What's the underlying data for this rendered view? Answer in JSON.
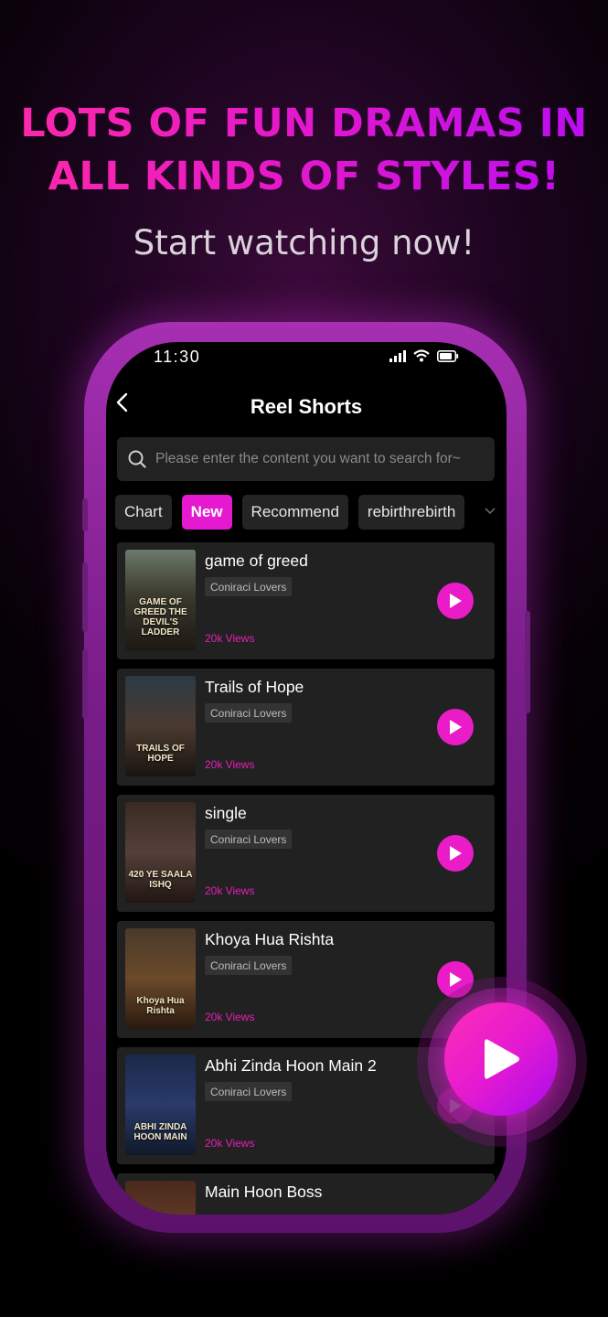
{
  "promo": {
    "headline_line1": "LOTS OF FUN DRAMAS IN",
    "headline_line2": "ALL KINDS OF STYLES!",
    "subheadline": "Start watching now!"
  },
  "status_bar": {
    "time": "11:30"
  },
  "nav": {
    "back_icon": "chevron-left-icon",
    "title": "Reel Shorts"
  },
  "search": {
    "placeholder": "Please enter the content you want to search for~"
  },
  "tabs": [
    {
      "label": "Chart",
      "active": false
    },
    {
      "label": "New",
      "active": true
    },
    {
      "label": "Recommend",
      "active": false
    },
    {
      "label": "rebirthrebirth",
      "active": false
    }
  ],
  "dramas": [
    {
      "title": "game of greed",
      "tag": "Coniraci Lovers",
      "views": "20k Views",
      "poster_text": "GAME OF GREED THE DEVIL'S LADDER"
    },
    {
      "title": "Trails of Hope",
      "tag": "Coniraci Lovers",
      "views": "20k Views",
      "poster_text": "TRAILS OF HOPE"
    },
    {
      "title": "single",
      "tag": "Coniraci Lovers",
      "views": "20k Views",
      "poster_text": "420 YE SAALA ISHQ"
    },
    {
      "title": "Khoya Hua Rishta",
      "tag": "Coniraci Lovers",
      "views": "20k Views",
      "poster_text": "Khoya Hua Rishta"
    },
    {
      "title": "Abhi Zinda Hoon Main 2",
      "tag": "Coniraci Lovers",
      "views": "20k Views",
      "poster_text": "ABHI ZINDA HOON MAIN"
    },
    {
      "title": "Main Hoon Boss",
      "tag": "",
      "views": "",
      "poster_text": ""
    }
  ],
  "colors": {
    "accent": "#e51ad0",
    "views": "#e81fb7",
    "card_bg": "#212121"
  }
}
